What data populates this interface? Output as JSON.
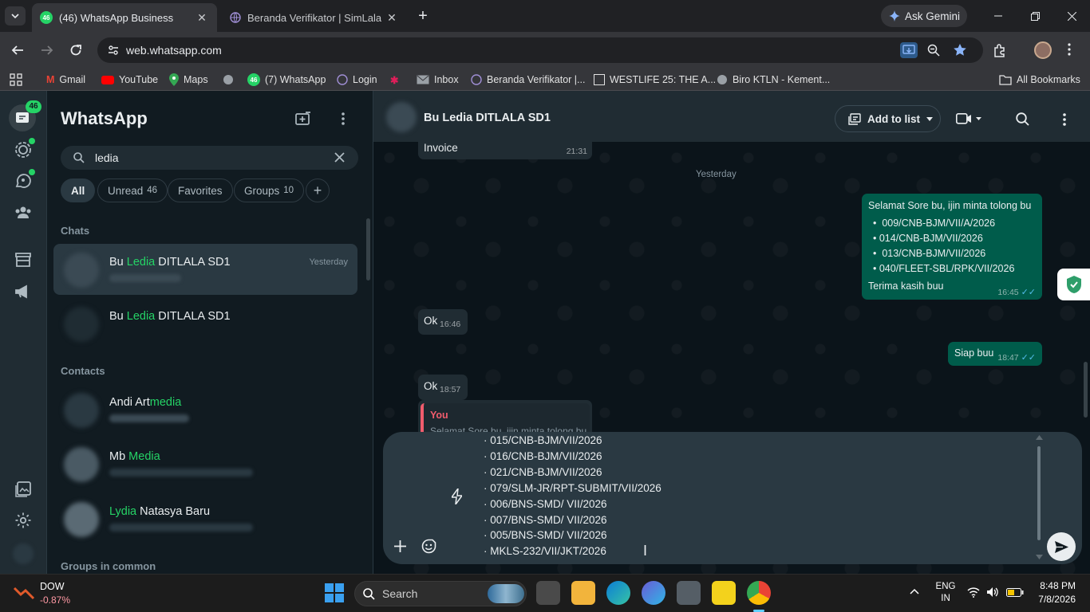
{
  "browser": {
    "tabs": [
      {
        "label": "(46) WhatsApp Business",
        "favicon_badge": "46"
      },
      {
        "label": "Beranda Verifikator | SimLala"
      }
    ],
    "ask_gemini": "Ask Gemini",
    "url": "web.whatsapp.com",
    "bookmarks": [
      "Gmail",
      "YouTube",
      "Maps",
      "(7) WhatsApp",
      "Login",
      "Inbox",
      "Beranda Verifikator |...",
      "WESTLIFE 25: THE A...",
      "Biro KTLN - Kement..."
    ],
    "bookmark_whatsapp_badge": "46",
    "all_bookmarks": "All Bookmarks"
  },
  "rail": {
    "chats_badge": "46"
  },
  "sidebar": {
    "title": "WhatsApp",
    "search_value": "ledia",
    "filters": [
      {
        "label": "All",
        "count": ""
      },
      {
        "label": "Unread",
        "count": "46"
      },
      {
        "label": "Favorites",
        "count": ""
      },
      {
        "label": "Groups",
        "count": "10"
      }
    ],
    "chats_label": "Chats",
    "contacts_label": "Contacts",
    "groups_label": "Groups in common",
    "chats": [
      {
        "pre": "Bu ",
        "hl": "Ledia",
        "post": " DITLALA SD1",
        "time": "Yesterday"
      },
      {
        "pre": "Bu ",
        "hl": "Ledia",
        "post": " DITLALA SD1",
        "time": ""
      }
    ],
    "contacts": [
      {
        "pre": "Andi Art",
        "hl": "media",
        "post": ""
      },
      {
        "pre": "Mb ",
        "hl": "Media",
        "post": ""
      },
      {
        "pre": "",
        "hl": "Lydia",
        "post": " Natasya Baru"
      }
    ]
  },
  "chat": {
    "header_name": "Bu Ledia DITLALA SD1",
    "add_to_list": "Add to list",
    "date_divider": "Yesterday",
    "messages": {
      "invoice_text": "Invoice",
      "invoice_time": "21:31",
      "out1_greeting": "Selamat Sore bu, ijin minta tolong bu",
      "out1_items": [
        "009/CNB-BJM/VII/A/2026",
        "014/CNB-BJM/VII/2026",
        "013/CNB-BJM/VII/2026",
        "040/FLEET-SBL/RPK/VII/2026"
      ],
      "out1_thanks": "Terima kasih buu",
      "out1_time": "16:45",
      "in1_text": "Ok",
      "in1_time": "16:46",
      "out2_text": "Siap buu",
      "out2_time": "18:47",
      "in2_text": "Ok",
      "in2_time": "18:57",
      "quote_author": "You",
      "quote_text": "Selamat Sore bu, ijin minta tolong bu"
    },
    "composer_lines": [
      "015/CNB-BJM/VII/2026",
      "016/CNB-BJM/VII/2026",
      "021/CNB-BJM/VII/2026",
      "079/SLM-JR/RPT-SUBMIT/VII/2026",
      "006/BNS-SMD/ VII/2026",
      "007/BNS-SMD/ VII/2026",
      "005/BNS-SMD/ VII/2026",
      "MKLS-232/VII/JKT/2026"
    ]
  },
  "taskbar": {
    "stock_name": "DOW",
    "stock_change": "-0.87%",
    "search": "Search",
    "lang1": "ENG",
    "lang2": "IN",
    "time": "8:48 PM",
    "date": "7/8/2026"
  },
  "colors": {
    "whatsapp_green": "#25d366",
    "outgoing_bubble": "#005c4b",
    "incoming_bubble": "#202c33",
    "quote_accent": "#f15c6d"
  }
}
